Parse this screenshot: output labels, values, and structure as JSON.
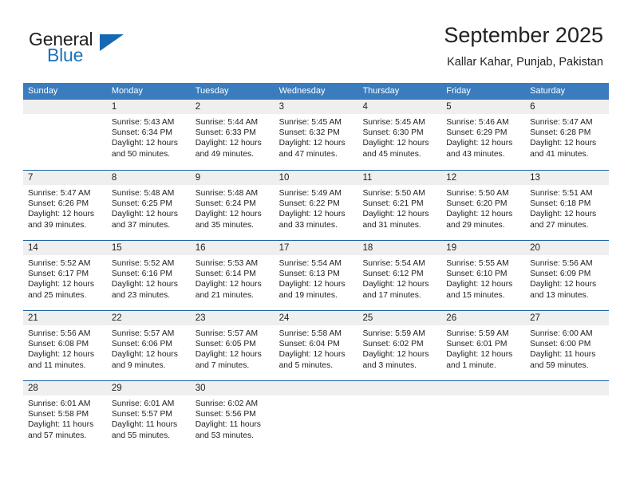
{
  "logo": {
    "word_top": "General",
    "word_bottom": "Blue",
    "triangle_color": "#1569b3",
    "text_color": "#231f20",
    "blue_color": "#1a73bd"
  },
  "header": {
    "title": "September 2025",
    "subtitle": "Kallar Kahar, Punjab, Pakistan"
  },
  "theme": {
    "header_row_bg": "#3a7cbe",
    "week_divider": "#1b63a8",
    "day_band_bg": "#efefef",
    "text": "#222222"
  },
  "calendar": {
    "weekday_headers": [
      "Sunday",
      "Monday",
      "Tuesday",
      "Wednesday",
      "Thursday",
      "Friday",
      "Saturday"
    ],
    "weeks": [
      [
        {
          "day": "",
          "sunrise": "",
          "sunset": "",
          "daylight_line1": "",
          "daylight_line2": "",
          "empty": true
        },
        {
          "day": "1",
          "sunrise": "Sunrise: 5:43 AM",
          "sunset": "Sunset: 6:34 PM",
          "daylight_line1": "Daylight: 12 hours",
          "daylight_line2": "and 50 minutes."
        },
        {
          "day": "2",
          "sunrise": "Sunrise: 5:44 AM",
          "sunset": "Sunset: 6:33 PM",
          "daylight_line1": "Daylight: 12 hours",
          "daylight_line2": "and 49 minutes."
        },
        {
          "day": "3",
          "sunrise": "Sunrise: 5:45 AM",
          "sunset": "Sunset: 6:32 PM",
          "daylight_line1": "Daylight: 12 hours",
          "daylight_line2": "and 47 minutes."
        },
        {
          "day": "4",
          "sunrise": "Sunrise: 5:45 AM",
          "sunset": "Sunset: 6:30 PM",
          "daylight_line1": "Daylight: 12 hours",
          "daylight_line2": "and 45 minutes."
        },
        {
          "day": "5",
          "sunrise": "Sunrise: 5:46 AM",
          "sunset": "Sunset: 6:29 PM",
          "daylight_line1": "Daylight: 12 hours",
          "daylight_line2": "and 43 minutes."
        },
        {
          "day": "6",
          "sunrise": "Sunrise: 5:47 AM",
          "sunset": "Sunset: 6:28 PM",
          "daylight_line1": "Daylight: 12 hours",
          "daylight_line2": "and 41 minutes."
        }
      ],
      [
        {
          "day": "7",
          "sunrise": "Sunrise: 5:47 AM",
          "sunset": "Sunset: 6:26 PM",
          "daylight_line1": "Daylight: 12 hours",
          "daylight_line2": "and 39 minutes."
        },
        {
          "day": "8",
          "sunrise": "Sunrise: 5:48 AM",
          "sunset": "Sunset: 6:25 PM",
          "daylight_line1": "Daylight: 12 hours",
          "daylight_line2": "and 37 minutes."
        },
        {
          "day": "9",
          "sunrise": "Sunrise: 5:48 AM",
          "sunset": "Sunset: 6:24 PM",
          "daylight_line1": "Daylight: 12 hours",
          "daylight_line2": "and 35 minutes."
        },
        {
          "day": "10",
          "sunrise": "Sunrise: 5:49 AM",
          "sunset": "Sunset: 6:22 PM",
          "daylight_line1": "Daylight: 12 hours",
          "daylight_line2": "and 33 minutes."
        },
        {
          "day": "11",
          "sunrise": "Sunrise: 5:50 AM",
          "sunset": "Sunset: 6:21 PM",
          "daylight_line1": "Daylight: 12 hours",
          "daylight_line2": "and 31 minutes."
        },
        {
          "day": "12",
          "sunrise": "Sunrise: 5:50 AM",
          "sunset": "Sunset: 6:20 PM",
          "daylight_line1": "Daylight: 12 hours",
          "daylight_line2": "and 29 minutes."
        },
        {
          "day": "13",
          "sunrise": "Sunrise: 5:51 AM",
          "sunset": "Sunset: 6:18 PM",
          "daylight_line1": "Daylight: 12 hours",
          "daylight_line2": "and 27 minutes."
        }
      ],
      [
        {
          "day": "14",
          "sunrise": "Sunrise: 5:52 AM",
          "sunset": "Sunset: 6:17 PM",
          "daylight_line1": "Daylight: 12 hours",
          "daylight_line2": "and 25 minutes."
        },
        {
          "day": "15",
          "sunrise": "Sunrise: 5:52 AM",
          "sunset": "Sunset: 6:16 PM",
          "daylight_line1": "Daylight: 12 hours",
          "daylight_line2": "and 23 minutes."
        },
        {
          "day": "16",
          "sunrise": "Sunrise: 5:53 AM",
          "sunset": "Sunset: 6:14 PM",
          "daylight_line1": "Daylight: 12 hours",
          "daylight_line2": "and 21 minutes."
        },
        {
          "day": "17",
          "sunrise": "Sunrise: 5:54 AM",
          "sunset": "Sunset: 6:13 PM",
          "daylight_line1": "Daylight: 12 hours",
          "daylight_line2": "and 19 minutes."
        },
        {
          "day": "18",
          "sunrise": "Sunrise: 5:54 AM",
          "sunset": "Sunset: 6:12 PM",
          "daylight_line1": "Daylight: 12 hours",
          "daylight_line2": "and 17 minutes."
        },
        {
          "day": "19",
          "sunrise": "Sunrise: 5:55 AM",
          "sunset": "Sunset: 6:10 PM",
          "daylight_line1": "Daylight: 12 hours",
          "daylight_line2": "and 15 minutes."
        },
        {
          "day": "20",
          "sunrise": "Sunrise: 5:56 AM",
          "sunset": "Sunset: 6:09 PM",
          "daylight_line1": "Daylight: 12 hours",
          "daylight_line2": "and 13 minutes."
        }
      ],
      [
        {
          "day": "21",
          "sunrise": "Sunrise: 5:56 AM",
          "sunset": "Sunset: 6:08 PM",
          "daylight_line1": "Daylight: 12 hours",
          "daylight_line2": "and 11 minutes."
        },
        {
          "day": "22",
          "sunrise": "Sunrise: 5:57 AM",
          "sunset": "Sunset: 6:06 PM",
          "daylight_line1": "Daylight: 12 hours",
          "daylight_line2": "and 9 minutes."
        },
        {
          "day": "23",
          "sunrise": "Sunrise: 5:57 AM",
          "sunset": "Sunset: 6:05 PM",
          "daylight_line1": "Daylight: 12 hours",
          "daylight_line2": "and 7 minutes."
        },
        {
          "day": "24",
          "sunrise": "Sunrise: 5:58 AM",
          "sunset": "Sunset: 6:04 PM",
          "daylight_line1": "Daylight: 12 hours",
          "daylight_line2": "and 5 minutes."
        },
        {
          "day": "25",
          "sunrise": "Sunrise: 5:59 AM",
          "sunset": "Sunset: 6:02 PM",
          "daylight_line1": "Daylight: 12 hours",
          "daylight_line2": "and 3 minutes."
        },
        {
          "day": "26",
          "sunrise": "Sunrise: 5:59 AM",
          "sunset": "Sunset: 6:01 PM",
          "daylight_line1": "Daylight: 12 hours",
          "daylight_line2": "and 1 minute."
        },
        {
          "day": "27",
          "sunrise": "Sunrise: 6:00 AM",
          "sunset": "Sunset: 6:00 PM",
          "daylight_line1": "Daylight: 11 hours",
          "daylight_line2": "and 59 minutes."
        }
      ],
      [
        {
          "day": "28",
          "sunrise": "Sunrise: 6:01 AM",
          "sunset": "Sunset: 5:58 PM",
          "daylight_line1": "Daylight: 11 hours",
          "daylight_line2": "and 57 minutes."
        },
        {
          "day": "29",
          "sunrise": "Sunrise: 6:01 AM",
          "sunset": "Sunset: 5:57 PM",
          "daylight_line1": "Daylight: 11 hours",
          "daylight_line2": "and 55 minutes."
        },
        {
          "day": "30",
          "sunrise": "Sunrise: 6:02 AM",
          "sunset": "Sunset: 5:56 PM",
          "daylight_line1": "Daylight: 11 hours",
          "daylight_line2": "and 53 minutes."
        },
        {
          "day": "",
          "sunrise": "",
          "sunset": "",
          "daylight_line1": "",
          "daylight_line2": "",
          "empty": true
        },
        {
          "day": "",
          "sunrise": "",
          "sunset": "",
          "daylight_line1": "",
          "daylight_line2": "",
          "empty": true
        },
        {
          "day": "",
          "sunrise": "",
          "sunset": "",
          "daylight_line1": "",
          "daylight_line2": "",
          "empty": true
        },
        {
          "day": "",
          "sunrise": "",
          "sunset": "",
          "daylight_line1": "",
          "daylight_line2": "",
          "empty": true
        }
      ]
    ]
  }
}
